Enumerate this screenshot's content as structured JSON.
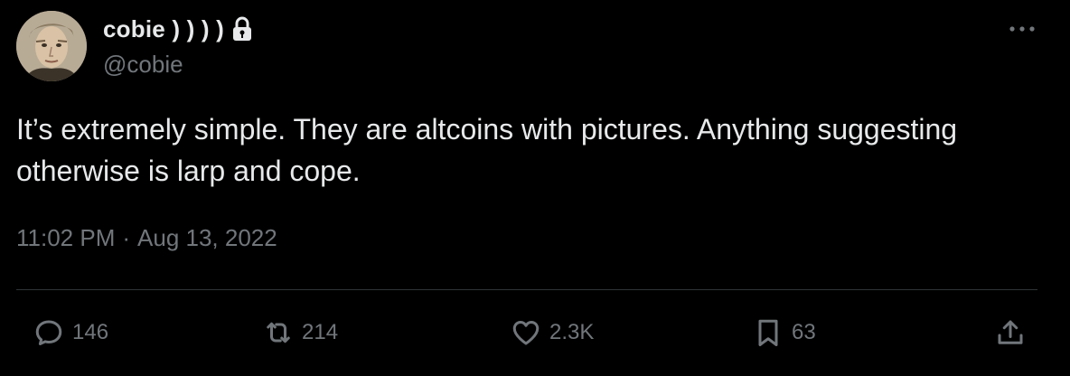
{
  "author": {
    "display_name": "cobie ) ) ) )",
    "handle": "@cobie",
    "avatar_icon": "avatar-photo",
    "protected_icon": "lock-icon"
  },
  "tweet": {
    "text": "It’s extremely simple. They are altcoins with pictures. Anything suggesting otherwise is larp and cope.",
    "time": "11:02 PM",
    "separator": "·",
    "date": "Aug 13, 2022"
  },
  "actions": {
    "replies": "146",
    "retweets": "214",
    "likes": "2.3K",
    "bookmarks": "63"
  },
  "icons": {
    "more": "more-horizontal-icon",
    "reply": "reply-icon",
    "retweet": "retweet-icon",
    "like": "heart-icon",
    "bookmark": "bookmark-icon",
    "share": "share-icon"
  },
  "colors": {
    "background": "#000000",
    "primary_text": "#e7e9ea",
    "secondary_text": "#71767b",
    "divider": "#2f3336"
  }
}
